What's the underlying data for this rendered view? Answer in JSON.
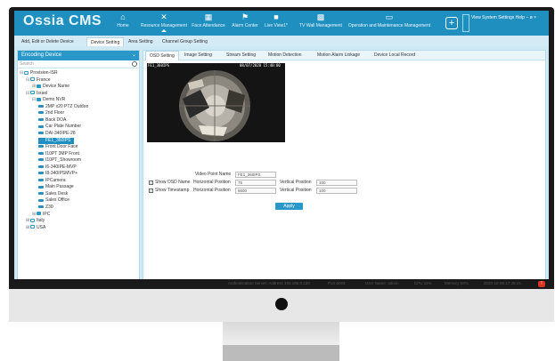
{
  "app": {
    "title": "Ossia CMS"
  },
  "nav": {
    "items": [
      {
        "label": "Home",
        "icon": "home-icon"
      },
      {
        "label": "Resource Management",
        "icon": "tools-icon"
      },
      {
        "label": "Face Attendance",
        "icon": "calendar-icon"
      },
      {
        "label": "Alarm Center",
        "icon": "alarm-icon"
      },
      {
        "label": "Live View1*",
        "icon": "camera-icon"
      },
      {
        "label": "TV Wall Management",
        "icon": "grid-icon"
      },
      {
        "label": "Operation and Maintenance Management",
        "icon": "monitor-icon"
      }
    ],
    "add_label": "+"
  },
  "top_right": {
    "text": "View System Settings Help  −  ø  ×"
  },
  "tabs": [
    "Add, Edit or Delete Device",
    "Device Setting",
    "Area Setting",
    "Channel Group Setting"
  ],
  "left_panel": {
    "title": "Encoding Device",
    "search_placeholder": "Search",
    "tree": [
      {
        "label": "Provision-ISR",
        "type": "home",
        "toggle": "⊟"
      },
      {
        "label": "France",
        "type": "home",
        "toggle": "⊟"
      },
      {
        "label": "Device Name",
        "type": "nvr",
        "toggle": "⊞"
      },
      {
        "label": "Israel",
        "type": "home",
        "toggle": "⊟"
      },
      {
        "label": "Demo NVR",
        "type": "nvr",
        "toggle": "⊟"
      },
      {
        "label": "2MP x20 PTZ Outdoo",
        "type": "cam"
      },
      {
        "label": "2nd Floor",
        "type": "cam"
      },
      {
        "label": "Back DOA",
        "type": "cam"
      },
      {
        "label": "Car Plate Number",
        "type": "cam"
      },
      {
        "label": "DAI-340IPE-28",
        "type": "cam"
      },
      {
        "label": "FE1_360IPS",
        "type": "cam",
        "selected": true
      },
      {
        "label": "Front Door Face",
        "type": "cam"
      },
      {
        "label": "I10PT 3MP Front",
        "type": "cam"
      },
      {
        "label": "I10PT_Showroom",
        "type": "cam"
      },
      {
        "label": "I6-340IPE-MVP",
        "type": "cam"
      },
      {
        "label": "I8-340IPSMVP+",
        "type": "cam"
      },
      {
        "label": "IPCamera",
        "type": "cam"
      },
      {
        "label": "Main Passage",
        "type": "cam"
      },
      {
        "label": "Sales Desk",
        "type": "cam"
      },
      {
        "label": "Sales Office",
        "type": "cam"
      },
      {
        "label": "Z30",
        "type": "cam"
      },
      {
        "label": "IPC",
        "type": "nvr",
        "toggle": "⊞"
      },
      {
        "label": "Italy",
        "type": "home",
        "toggle": "⊞"
      },
      {
        "label": "USA",
        "type": "home",
        "toggle": "⊞"
      }
    ]
  },
  "subtabs": [
    "OSD Setting",
    "Image Setting",
    "Stream Setting",
    "Motion Detection",
    "Motion Alarm Linkage",
    "Device Local Record"
  ],
  "video": {
    "timestamp_left": "FE1_360IPS",
    "timestamp_right": "08/07/2020 15:40:00"
  },
  "form": {
    "video_point_name_label": "Video Point Name",
    "video_point_name_value": "FE1_360IPS",
    "show_osd_label": "Show OSD Name",
    "show_timestamp_label": "Show Timestamp",
    "horizontal_label": "Horizontal Position",
    "vertical_label": "Vertical Position",
    "osd_h": "75",
    "osd_v": "100",
    "ts_h": "6600",
    "ts_v": "100",
    "apply_label": "Apply"
  },
  "status_bar": {
    "segments": [
      "Authentication Server: Address 192.168.0.220",
      "Port 6003",
      "User Name: admin",
      "CPU 11%",
      "Memory 50%",
      "2020-10-08 17:48:41"
    ]
  }
}
